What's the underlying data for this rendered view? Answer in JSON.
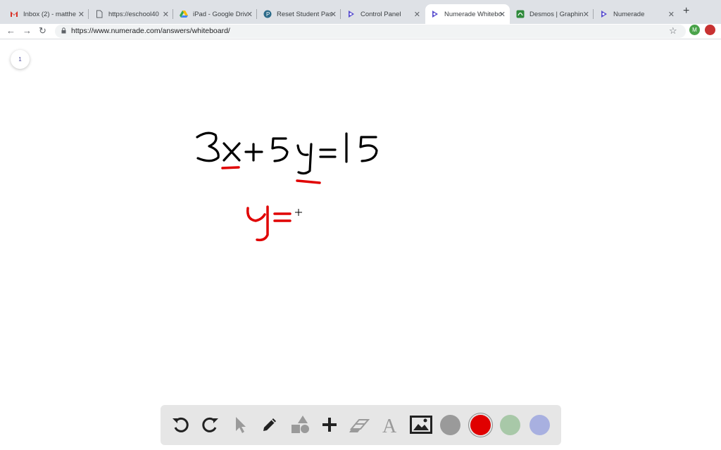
{
  "browser": {
    "tabs": [
      {
        "title": "Inbox (2) - matthe",
        "favicon": "gmail-icon"
      },
      {
        "title": "https://eschool40",
        "favicon": "page-icon"
      },
      {
        "title": "iPad - Google Driv",
        "favicon": "drive-icon"
      },
      {
        "title": "Reset Student Pas",
        "favicon": "pearson-icon"
      },
      {
        "title": "Control Panel",
        "favicon": "numerade-icon"
      },
      {
        "title": "Numerade Whitebo",
        "favicon": "numerade-icon",
        "active": true
      },
      {
        "title": "Desmos | Graphin",
        "favicon": "desmos-icon"
      },
      {
        "title": "Numerade",
        "favicon": "numerade-icon"
      }
    ],
    "url": "https://www.numerade.com/answers/whiteboard/",
    "profile_initial": "M"
  },
  "whiteboard": {
    "page_number": "1",
    "ink_color": "#000000",
    "accent_color": "#e00000"
  },
  "toolbar": {
    "tools": [
      "undo-icon",
      "redo-icon",
      "pointer-icon",
      "pencil-icon",
      "shapes-icon",
      "plus-icon",
      "eraser-icon",
      "text-icon",
      "image-icon"
    ],
    "colors": [
      "#9a9a9a",
      "#e00000",
      "#a8c8a8",
      "#a8b0e0"
    ],
    "selected_color": "#e00000"
  }
}
